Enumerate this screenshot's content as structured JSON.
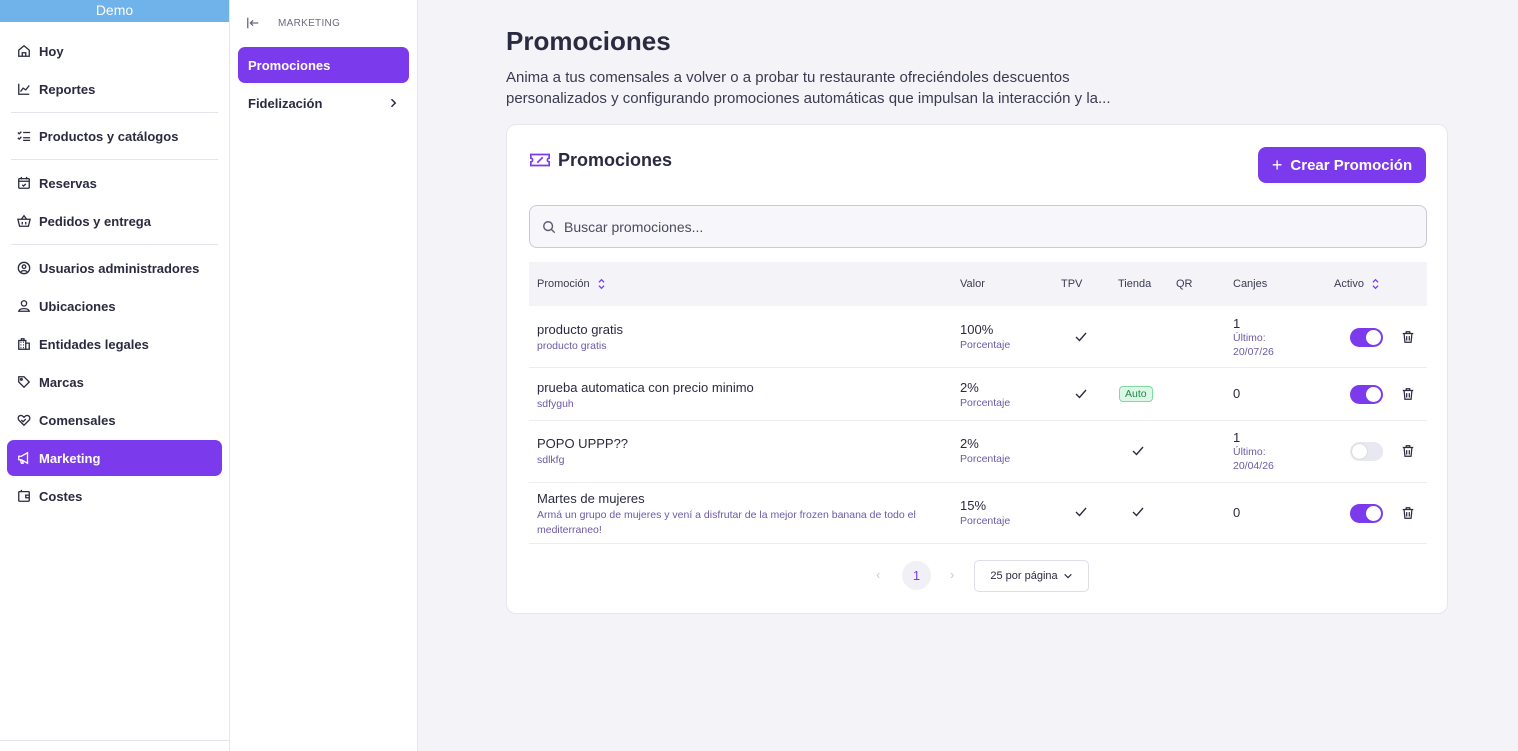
{
  "sidebar": {
    "brand": "Demo",
    "items": [
      {
        "label": "Hoy",
        "icon": "home-icon"
      },
      {
        "label": "Reportes",
        "icon": "chart-icon"
      },
      {
        "label": "Productos y catálogos",
        "icon": "checklist-icon"
      },
      {
        "label": "Reservas",
        "icon": "calendar-icon"
      },
      {
        "label": "Pedidos y entrega",
        "icon": "basket-icon"
      },
      {
        "label": "Usuarios administradores",
        "icon": "user-circle-icon"
      },
      {
        "label": "Ubicaciones",
        "icon": "location-user-icon"
      },
      {
        "label": "Entidades legales",
        "icon": "building-icon"
      },
      {
        "label": "Marcas",
        "icon": "tag-icon"
      },
      {
        "label": "Comensales",
        "icon": "heart-hand-icon"
      },
      {
        "label": "Marketing",
        "icon": "megaphone-icon",
        "active": true
      },
      {
        "label": "Costes",
        "icon": "wallet-icon"
      }
    ]
  },
  "subpanel": {
    "title": "MARKETING",
    "items": [
      {
        "label": "Promociones",
        "active": true
      },
      {
        "label": "Fidelización",
        "has_children": true
      }
    ]
  },
  "page": {
    "title": "Promociones",
    "description": "Anima a tus comensales a volver o a probar tu restaurante ofreciéndoles descuentos personalizados y configurando promociones automáticas que impulsan la interacción y la..."
  },
  "card": {
    "title": "Promociones",
    "create_label": "Crear Promoción",
    "search_placeholder": "Buscar promociones..."
  },
  "table": {
    "columns": [
      "Promoción",
      "Valor",
      "TPV",
      "Tienda",
      "QR",
      "Canjes",
      "Activo"
    ],
    "rows": [
      {
        "name": "producto gratis",
        "description": "producto gratis",
        "value": "100%",
        "value_type": "Porcentaje",
        "tpv": true,
        "tienda": "",
        "qr": false,
        "canjes": "1",
        "ultimo_label": "Último:",
        "ultimo_date": "20/07/26",
        "active": true
      },
      {
        "name": "prueba automatica con precio minimo",
        "description": "sdfyguh",
        "value": "2%",
        "value_type": "Porcentaje",
        "tpv": true,
        "tienda": "Auto",
        "qr": false,
        "canjes": "0",
        "ultimo_label": "",
        "ultimo_date": "",
        "active": true
      },
      {
        "name": "POPO UPPP??",
        "description": "sdlkfg",
        "value": "2%",
        "value_type": "Porcentaje",
        "tpv": false,
        "tienda": "check",
        "qr": false,
        "canjes": "1",
        "ultimo_label": "Último:",
        "ultimo_date": "20/04/26",
        "active": false
      },
      {
        "name": "Martes de mujeres",
        "description": "Armá un grupo de mujeres y vení a disfrutar de la mejor frozen banana de todo el mediterraneo!",
        "value": "15%",
        "value_type": "Porcentaje",
        "tpv": true,
        "tienda": "check",
        "qr": false,
        "canjes": "0",
        "ultimo_label": "",
        "ultimo_date": "",
        "active": true
      }
    ]
  },
  "pagination": {
    "prev": "‹",
    "current": "1",
    "next": "›",
    "page_size": "25 por página"
  },
  "colors": {
    "accent": "#7c3aed",
    "brand_bar": "#6fb3ea",
    "badge_green": "#1f8a4a"
  }
}
